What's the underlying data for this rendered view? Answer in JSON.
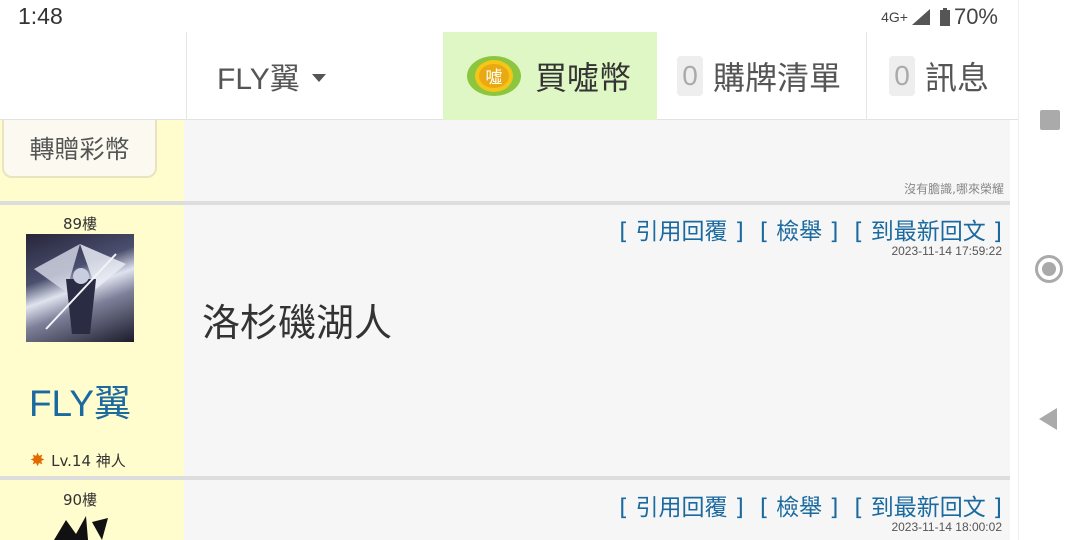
{
  "status_bar": {
    "time": "1:48",
    "network": "4G+",
    "battery": "70%"
  },
  "header": {
    "user": "FLY翼",
    "buy_label": "買噓幣",
    "coin_glyph": "噓",
    "cart_count": "0",
    "cart_label": "購牌清單",
    "msg_count": "0",
    "msg_label": "訊息"
  },
  "previous_post": {
    "gift_button": "轉贈彩幣",
    "signature": "沒有膽識,哪來榮耀"
  },
  "posts": [
    {
      "floor": "89樓",
      "author": "FLY翼",
      "level": "Lv.14 神人",
      "actions": [
        "[ 引用回覆 ]",
        "[ 檢舉 ]",
        "[ 到最新回文 ]"
      ],
      "timestamp": "2023-11-14 17:59:22",
      "body": "洛杉磯湖人"
    },
    {
      "floor": "90樓",
      "actions": [
        "[ 引用回覆 ]",
        "[ 檢舉 ]",
        "[ 到最新回文 ]"
      ],
      "timestamp": "2023-11-14 18:00:02"
    }
  ],
  "colors": {
    "accent_link": "#1a6aa0",
    "buy_bg": "#dff7c4",
    "sidebar_bg": "#fffcce"
  }
}
